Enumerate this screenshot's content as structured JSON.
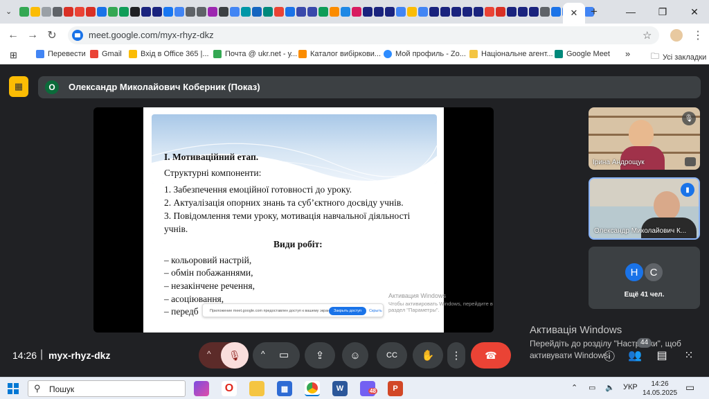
{
  "browser": {
    "active_tab_close": "✕",
    "new_tab": "+",
    "url": "meet.google.com/myx-rhyz-dkz",
    "bookmarks": [
      {
        "label": "Перевести"
      },
      {
        "label": "Gmail"
      },
      {
        "label": "Вхід в Office 365 |..."
      },
      {
        "label": "Почта @ ukr.net - у..."
      },
      {
        "label": "Каталог вибіркови..."
      },
      {
        "label": "Мой профиль - Zo..."
      },
      {
        "label": "Національне агент..."
      },
      {
        "label": "Google Meet"
      }
    ],
    "bookmarks_more": "»",
    "all_bookmarks": "Усі закладки"
  },
  "meet": {
    "presenter_initial": "О",
    "presenter_title": "Олександр Миколайович Коберник (Показ)",
    "slide": {
      "heading": "I. Мотиваційний етап.",
      "subheading": "Структурні компоненти:",
      "items": [
        "1. Забезпечення емоційної готовності до уроку.",
        "2. Актуалізація опорних знань та суб’єктного досвіду учнів.",
        "3.  Повідомлення  теми  уроку,  мотивація  навчальної  діяльності",
        "учнів."
      ],
      "work_types_title": "Види робіт:",
      "work_types": [
        "–   кольоровий настрій,",
        "–   обмін побажаннями,",
        "–   незакінчене речення,",
        "–   асоціювання,",
        "–   передб"
      ],
      "watermark_title": "Активация Windows",
      "watermark_sub_1": "Чтобы активировать Windows, перейдите в",
      "watermark_sub_2": "раздел \"Параметры\".",
      "popup_msg": "Приложение meet.google.com предоставлен доступ к вашему экрану.",
      "popup_close": "Закрыть доступ",
      "popup_hide": "Скрыть"
    },
    "participants": [
      {
        "name": "Ірина Андрощук"
      },
      {
        "name": "Олександр Миколайович К..."
      }
    ],
    "others": {
      "avatars": [
        "Н",
        "С"
      ],
      "label": "Ещё 41 чел."
    },
    "activate_windows": {
      "title": "Активація Windows",
      "line1": "Перейдіть до розділу \"Настройки\", щоб",
      "line2": "активувати Windows."
    },
    "time": "14:26",
    "separator": "|",
    "meeting_code": "myx-rhyz-dkz",
    "participant_count": "44",
    "colors": {
      "end_call": "#ea4335",
      "accent": "#1a73e8",
      "present_badge": "#fbbc04"
    }
  },
  "taskbar": {
    "search_placeholder": "Пошук",
    "lang": "УКР",
    "clock_time": "14:26",
    "clock_date": "14.05.2025",
    "viber_badge": "48"
  }
}
